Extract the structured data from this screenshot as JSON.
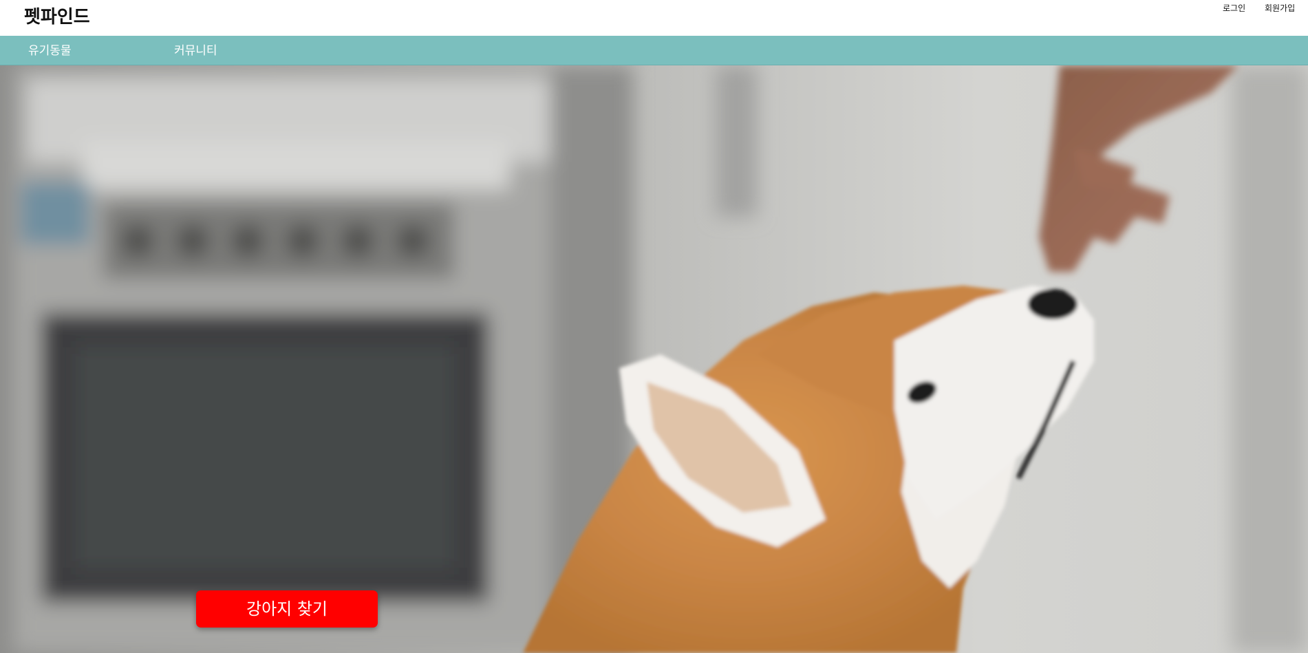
{
  "header": {
    "brand": "펫파인드",
    "login": "로그인",
    "signup": "회원가입"
  },
  "nav": {
    "items": [
      {
        "label": "유기동물"
      },
      {
        "label": "커뮤니티"
      }
    ]
  },
  "hero": {
    "image_subject": "puppy sniffing a hand",
    "cta_label": "강아지 찾기"
  },
  "colors": {
    "nav_background": "#7bbfbe",
    "cta_background": "#ff0000",
    "cta_text": "#ffffff",
    "header_background": "#ffffff"
  }
}
